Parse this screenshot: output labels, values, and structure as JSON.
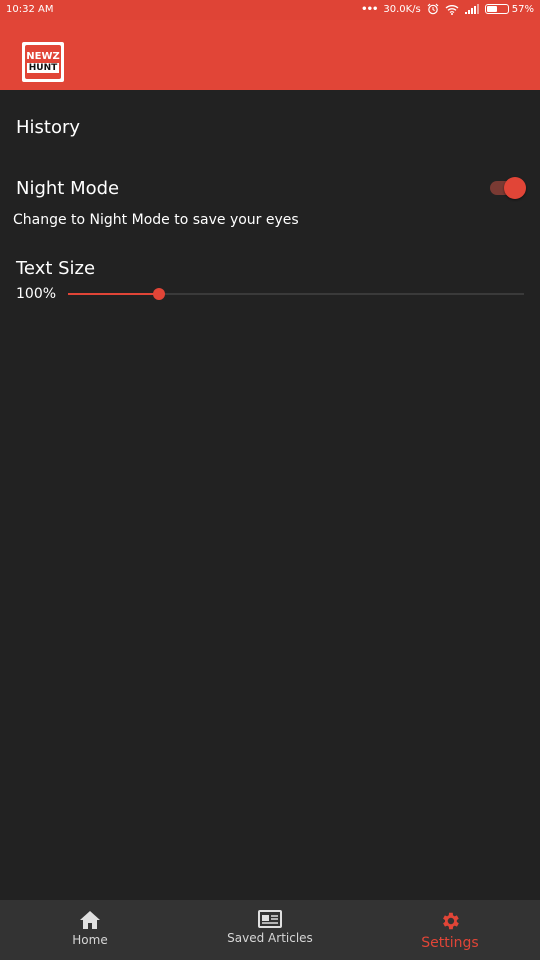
{
  "status_bar": {
    "time": "10:32 AM",
    "network_speed": "30.0K/s",
    "battery_percent_label": "57%",
    "battery_level": 0.57,
    "icons": [
      "more-dots-icon",
      "alarm-icon",
      "wifi-icon",
      "signal-icon",
      "battery-icon"
    ]
  },
  "app_bar": {
    "logo_line1": "NEWZ",
    "logo_line2": "HUNT",
    "background": "#e14537"
  },
  "settings": {
    "history_label": "History",
    "night_mode": {
      "title": "Night Mode",
      "description": "Change to Night Mode to save your eyes",
      "enabled": true
    },
    "text_size": {
      "title": "Text Size",
      "value_label": "100%",
      "slider_fraction": 0.2
    }
  },
  "bottom_nav": {
    "items": [
      {
        "label": "Home",
        "icon": "home-icon",
        "active": false
      },
      {
        "label": "Saved Articles",
        "icon": "saved-articles-icon",
        "active": false
      },
      {
        "label": "Settings",
        "icon": "gear-icon",
        "active": true
      }
    ]
  },
  "colors": {
    "accent": "#e14537",
    "background": "#222222",
    "nav_background": "#333333"
  }
}
